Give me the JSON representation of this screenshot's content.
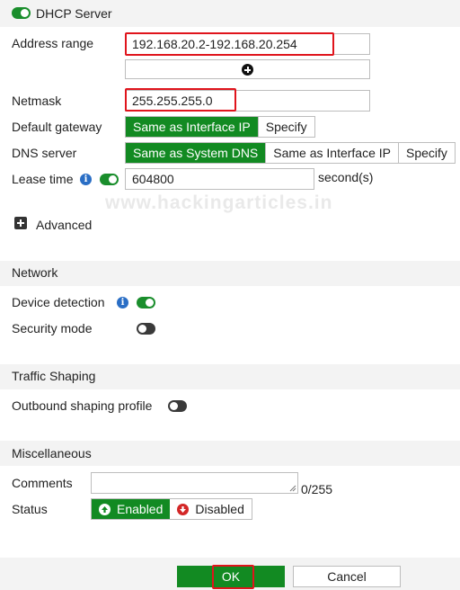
{
  "dhcp": {
    "title": "DHCP Server",
    "address_range_label": "Address range",
    "address_range_value": "192.168.20.2-192.168.20.254",
    "netmask_label": "Netmask",
    "netmask_value": "255.255.255.0",
    "gateway_label": "Default gateway",
    "gateway_options": [
      "Same as Interface IP",
      "Specify"
    ],
    "dns_label": "DNS server",
    "dns_options": [
      "Same as System DNS",
      "Same as Interface IP",
      "Specify"
    ],
    "lease_label": "Lease time",
    "lease_value": "604800",
    "lease_unit": "second(s)",
    "advanced_label": "Advanced"
  },
  "watermark": "www.hackingarticles.in",
  "network": {
    "title": "Network",
    "device_detection_label": "Device detection",
    "security_mode_label": "Security mode"
  },
  "traffic": {
    "title": "Traffic Shaping",
    "outbound_label": "Outbound shaping profile"
  },
  "misc": {
    "title": "Miscellaneous",
    "comments_label": "Comments",
    "comments_counter": "0/255",
    "status_label": "Status",
    "enabled_label": "Enabled",
    "disabled_label": "Disabled"
  },
  "footer": {
    "ok_label": "OK",
    "cancel_label": "Cancel"
  },
  "colors": {
    "accent_green": "#128a22",
    "highlight_red": "#e0141c",
    "info_blue": "#2a6ec5"
  }
}
